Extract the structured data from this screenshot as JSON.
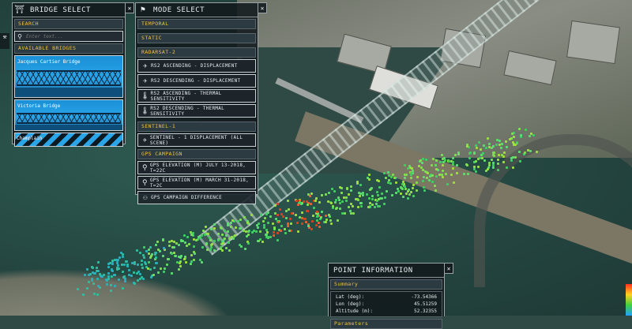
{
  "bridge_select": {
    "title": "BRIDGE SELECT",
    "search_header": "SEARCH",
    "search_placeholder": "Enter text...",
    "available_header": "AVAILABLE BRIDGES",
    "bridges": [
      {
        "label": "Jacques Cartier Bridge"
      },
      {
        "label": "Victoria Bridge"
      },
      {
        "label": "Champlain"
      }
    ]
  },
  "mode_select": {
    "title": "MODE SELECT",
    "temporal": "TEMPORAL",
    "static": "STATIC",
    "radarsat": "RADARSAT-2",
    "rs2_items": [
      "RS2 ASCENDING - DISPLACEMENT",
      "RS2 DESCENDING - DISPLACEMENT",
      "RS2 ASCENDING - THERMAL SENSITIVITY",
      "RS2 DESCENDING - THERMAL SENSITIVITY"
    ],
    "sentinel": "SENTINEL-1",
    "sentinel_items": [
      "SENTINEL - 1 DISPLACEMENT (ALL SCENE)"
    ],
    "gps": "GPS CAMPAIGN",
    "gps_items": [
      "GPS ELEVATION (M) JULY 13-2018, T=22C",
      "GPS ELEVATION (M) MARCH 31-2018, T=2C",
      "GPS CAMPAIGN DIFFERENCE"
    ]
  },
  "point_info": {
    "title": "POINT INFORMATION",
    "summary_header": "Summary",
    "rows": [
      {
        "key": "Lat (deg):",
        "value": "-73.54366"
      },
      {
        "key": "Lon (deg):",
        "value": "45.51259"
      },
      {
        "key": "Altitude (m):",
        "value": "52.32355"
      }
    ],
    "params_header": "Parameters"
  },
  "colors": {
    "accent": "#f0c040",
    "panel_border": "#9aa4a8"
  }
}
